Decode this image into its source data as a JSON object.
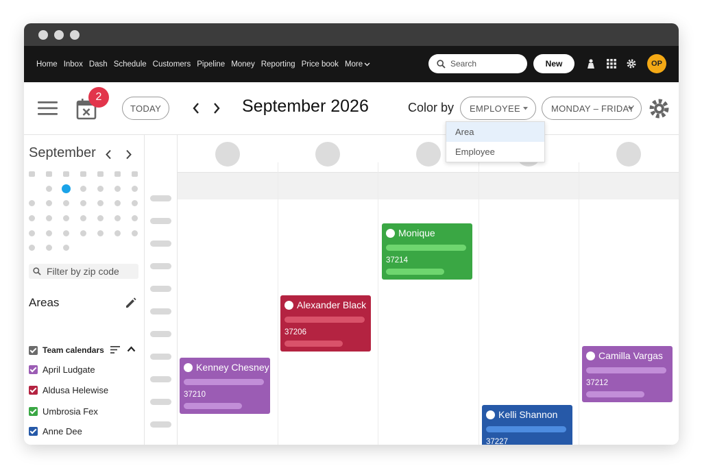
{
  "nav": {
    "links": [
      "Home",
      "Inbox",
      "Dash",
      "Schedule",
      "Customers",
      "Pipeline",
      "Money",
      "Reporting",
      "Price book",
      "More"
    ],
    "search_label": "Search",
    "new_label": "New",
    "avatar_initials": "OP"
  },
  "toolbar": {
    "notification_count": "2",
    "today_label": "TODAY",
    "title": "September 2026",
    "color_by_label": "Color by",
    "color_by_value": "EMPLOYEE",
    "range_value": "MONDAY – FRIDAY"
  },
  "dropdown": {
    "options": [
      "Area",
      "Employee"
    ],
    "highlighted": "Area"
  },
  "sidebar": {
    "month": "September",
    "filter_placeholder": "Filter by zip code",
    "areas_title": "Areas",
    "team_label": "Team calendars",
    "calendars": [
      {
        "name": "April Ludgate",
        "color": "#9b5cb4"
      },
      {
        "name": "Aldusa Helewise",
        "color": "#b42341"
      },
      {
        "name": "Umbrosia Fex",
        "color": "#3aa744"
      },
      {
        "name": "Anne Dee",
        "color": "#2659a8"
      }
    ]
  },
  "events": [
    {
      "name": "Monique",
      "code": "37214",
      "color": "#3aa744",
      "bar": "#6ed66f"
    },
    {
      "name": "Alexander Black",
      "code": "37206",
      "color": "#b42341",
      "bar": "#d9526a"
    },
    {
      "name": "Kenney Chesney",
      "code": "37210",
      "color": "#9b5cb4",
      "bar": "#c28ed8"
    },
    {
      "name": "Camilla Vargas",
      "code": "37212",
      "color": "#9b5cb4",
      "bar": "#c28ed8"
    },
    {
      "name": "Kelli Shannon",
      "code": "37227",
      "color": "#2659a8",
      "bar": "#4d8ce0"
    }
  ]
}
